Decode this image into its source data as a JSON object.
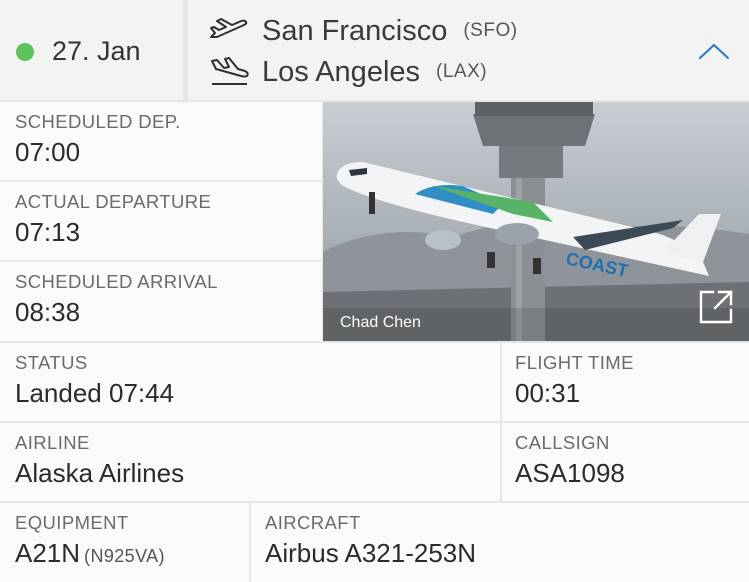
{
  "header": {
    "status_color": "#5cc35c",
    "date": "27. Jan",
    "origin": {
      "city": "San Francisco",
      "code": "(SFO)"
    },
    "destination": {
      "city": "Los Angeles",
      "code": "(LAX)"
    },
    "icons": {
      "departure": "plane-takeoff-icon",
      "arrival": "plane-landing-icon",
      "toggle": "chevron-up-icon"
    }
  },
  "times": {
    "scheduled_departure": {
      "label": "SCHEDULED DEP.",
      "value": "07:00"
    },
    "actual_departure": {
      "label": "ACTUAL DEPARTURE",
      "value": "07:13"
    },
    "scheduled_arrival": {
      "label": "SCHEDULED ARRIVAL",
      "value": "08:38"
    }
  },
  "photo": {
    "credit": "Chad Chen",
    "icon": "external-link-icon",
    "livery_text": "COAST"
  },
  "details": {
    "status": {
      "label": "STATUS",
      "value": "Landed 07:44"
    },
    "flight_time": {
      "label": "FLIGHT TIME",
      "value": "00:31"
    },
    "airline": {
      "label": "AIRLINE",
      "value": "Alaska Airlines"
    },
    "callsign": {
      "label": "CALLSIGN",
      "value": "ASA1098"
    },
    "equipment": {
      "label": "EQUIPMENT",
      "value": "A21N",
      "registration": "(N925VA)"
    },
    "aircraft": {
      "label": "AIRCRAFT",
      "value": "Airbus A321-253N"
    }
  },
  "accent_color": "#2f7cc0"
}
